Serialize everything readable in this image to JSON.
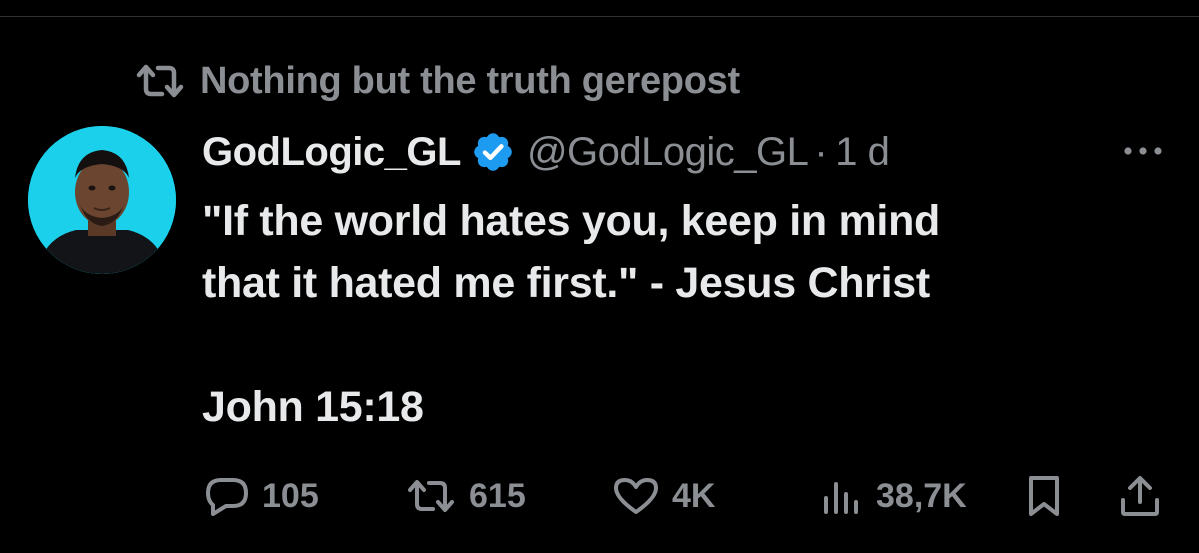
{
  "repost": {
    "label": "Nothing but the truth gerepost",
    "icon": "repost-icon"
  },
  "author": {
    "display_name": "GodLogic_GL",
    "handle": "@GodLogic_GL",
    "separator": "·",
    "timestamp": "1 d",
    "verified": true,
    "avatar_bg": "#1ad0ea"
  },
  "tweet": {
    "lines": [
      "\"If the world hates you, keep in mind",
      "that it hated me first.\" - Jesus Christ"
    ],
    "reference": "John 15:18"
  },
  "actions": {
    "reply": {
      "count": "105",
      "icon": "reply-icon"
    },
    "repost": {
      "count": "615",
      "icon": "repost-icon"
    },
    "like": {
      "count": "4K",
      "icon": "heart-icon"
    },
    "views": {
      "count": "38,7K",
      "icon": "views-icon"
    },
    "bookmark": {
      "icon": "bookmark-icon"
    },
    "share": {
      "icon": "share-icon"
    }
  },
  "colors": {
    "background": "#000000",
    "text_primary": "#e7e9ea",
    "text_secondary": "#8b8f94",
    "verified_blue": "#1d9bf0",
    "divider": "#2f3336"
  }
}
